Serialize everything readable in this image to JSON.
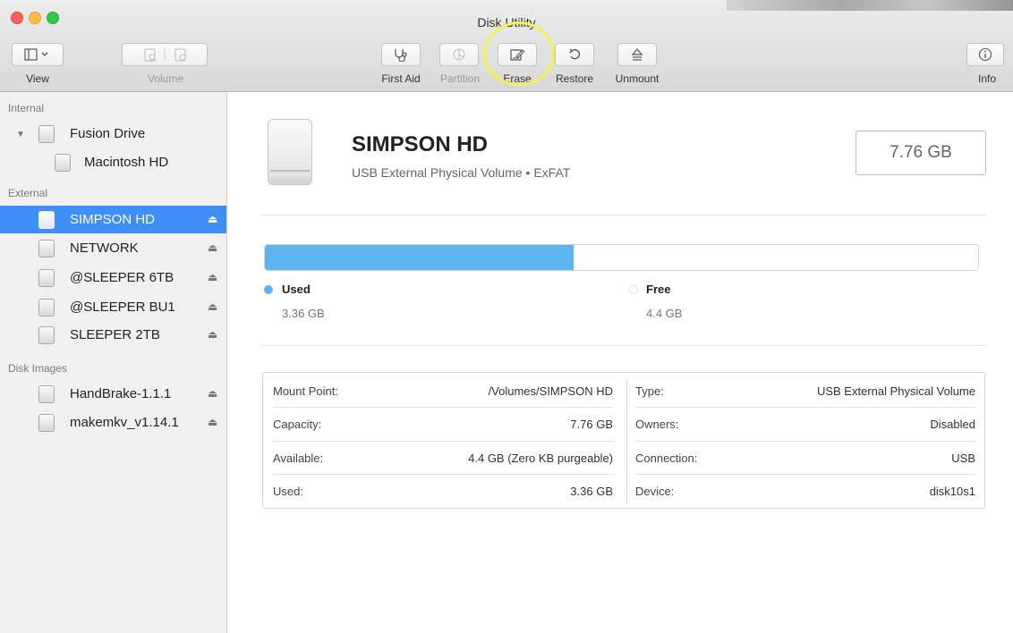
{
  "window": {
    "title": "Disk Utility"
  },
  "toolbar": {
    "view_label": "View",
    "volume_label": "Volume",
    "first_aid_label": "First Aid",
    "partition_label": "Partition",
    "erase_label": "Erase",
    "restore_label": "Restore",
    "unmount_label": "Unmount",
    "info_label": "Info"
  },
  "sidebar": {
    "internal_header": "Internal",
    "external_header": "External",
    "disk_images_header": "Disk Images",
    "internal_items": [
      "Fusion Drive",
      "Macintosh HD"
    ],
    "external_items": [
      "SIMPSON HD",
      "NETWORK",
      "@SLEEPER 6TB",
      "@SLEEPER BU1",
      "SLEEPER 2TB"
    ],
    "disk_image_items": [
      "HandBrake-1.1.1",
      "makemkv_v1.14.1"
    ],
    "selected": "SIMPSON HD",
    "eject_glyph": "⏏"
  },
  "volume": {
    "name": "SIMPSON HD",
    "description": "USB External Physical Volume • ExFAT",
    "capacity_display": "7.76 GB"
  },
  "usage": {
    "used_fraction": 0.433,
    "used_color": "#5db5ef",
    "used_title": "Used",
    "used_value": "3.36 GB",
    "free_title": "Free",
    "free_value": "4.4 GB"
  },
  "info": {
    "left": [
      {
        "label": "Mount Point:",
        "value": "/Volumes/SIMPSON HD"
      },
      {
        "label": "Capacity:",
        "value": "7.76 GB"
      },
      {
        "label": "Available:",
        "value": "4.4 GB (Zero KB purgeable)"
      },
      {
        "label": "Used:",
        "value": "3.36 GB"
      }
    ],
    "right": [
      {
        "label": "Type:",
        "value": "USB External Physical Volume"
      },
      {
        "label": "Owners:",
        "value": "Disabled"
      },
      {
        "label": "Connection:",
        "value": "USB"
      },
      {
        "label": "Device:",
        "value": "disk10s1"
      }
    ]
  },
  "colors": {
    "selection": "#3f8ef5",
    "highlight_circle": "#f5f04a"
  }
}
